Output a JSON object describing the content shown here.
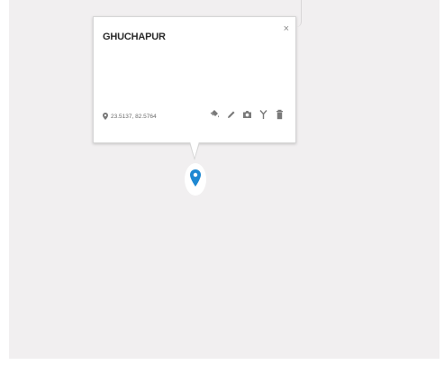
{
  "map": {
    "background_color": "#f1eff0"
  },
  "popup": {
    "title": "GHUCHAPUR",
    "close_label": "×",
    "coordinates": "23.5137, 82.5764",
    "toolbar_icons": [
      "paint-bucket-icon",
      "pencil-icon",
      "camera-icon",
      "route-fork-icon",
      "trash-icon"
    ]
  },
  "marker": {
    "icon": "map-pin-icon",
    "color": "#1e88d2"
  }
}
